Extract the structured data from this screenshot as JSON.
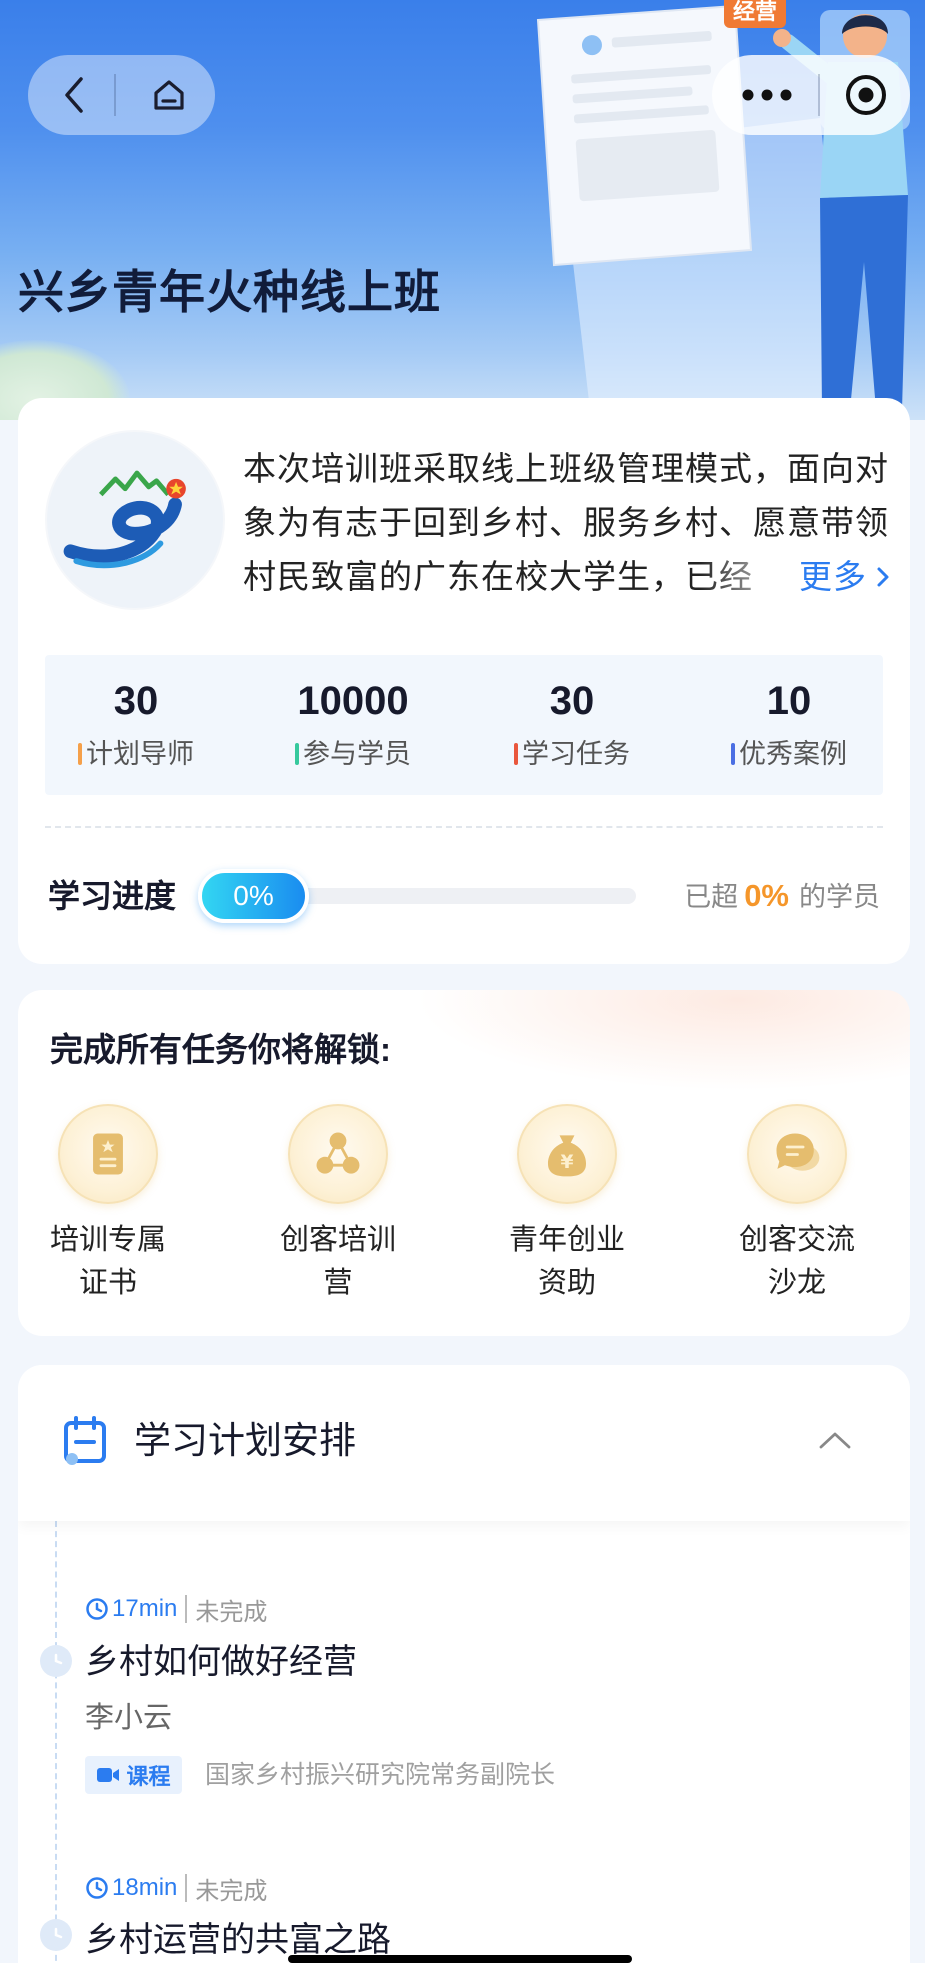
{
  "theme": {
    "accent": "#2b7cf0",
    "highlight": "#f5962a"
  },
  "nav": {
    "back_icon": "chevron-left-icon",
    "home_icon": "home-icon",
    "more_icon": "more-dots-icon",
    "miniapp_icon": "target-icon"
  },
  "banner": {
    "title": "兴乡青年火种线上班",
    "illustration_tag": "经营"
  },
  "intro": {
    "description": "本次培训班采取线上班级管理模式，面向对象为有志于回到乡村、服务乡村、愿意带领村民致富的广东在校大学生，已经",
    "more_label": "更多",
    "more_icon": "chevron-right-icon",
    "stats": [
      {
        "value": "30",
        "label": "计划导师",
        "color": "#f5a04a"
      },
      {
        "value": "10000",
        "label": "参与学员",
        "color": "#36c99d"
      },
      {
        "value": "30",
        "label": "学习任务",
        "color": "#e9573d"
      },
      {
        "value": "10",
        "label": "优秀案例",
        "color": "#4b6fe3"
      }
    ]
  },
  "progress": {
    "label": "学习进度",
    "value": "0%",
    "exceed_prefix": "已超",
    "exceed_value": "0%",
    "exceed_suffix": "的学员"
  },
  "unlock": {
    "title": "完成所有任务你将解锁:",
    "items": [
      {
        "label": "培训专属证书",
        "icon": "certificate-icon"
      },
      {
        "label": "创客培训营",
        "icon": "group-icon"
      },
      {
        "label": "青年创业资助",
        "icon": "money-bag-icon"
      },
      {
        "label": "创客交流沙龙",
        "icon": "chat-bubbles-icon"
      }
    ]
  },
  "plan": {
    "title": "学习计划安排",
    "header_icon": "calendar-icon",
    "collapse_icon": "chevron-up-icon",
    "lessons": [
      {
        "duration": "17min",
        "status": "未完成",
        "title": "乡村如何做好经营",
        "teacher": "李小云",
        "type": "课程",
        "type_icon": "video-icon",
        "teacher_title": "国家乡村振兴研究院常务副院长"
      },
      {
        "duration": "18min",
        "status": "未完成",
        "title": "乡村运营的共富之路"
      }
    ]
  }
}
